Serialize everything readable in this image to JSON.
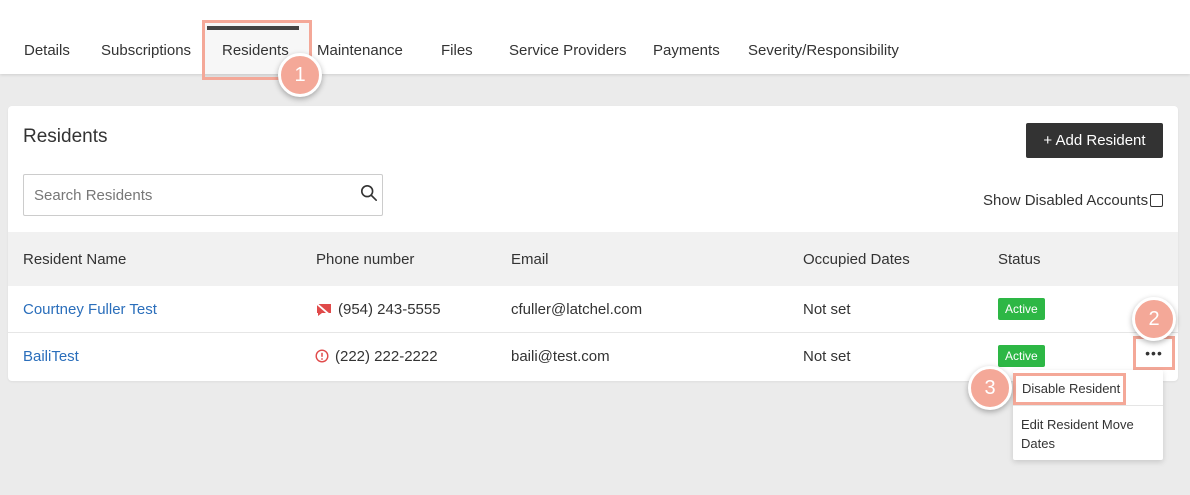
{
  "nav": {
    "tabs": [
      "Details",
      "Subscriptions",
      "Residents",
      "Maintenance",
      "Files",
      "Service Providers",
      "Payments",
      "Severity/Responsibility"
    ],
    "active_tab": "Residents"
  },
  "annotations": [
    "1",
    "2",
    "3"
  ],
  "residents_panel": {
    "title": "Residents",
    "add_button": "+ Add Resident",
    "search_placeholder": "Search Residents",
    "show_disabled_label": "Show Disabled Accounts",
    "columns": [
      "Resident Name",
      "Phone number",
      "Email",
      "Occupied Dates",
      "Status"
    ],
    "rows": [
      {
        "name": "Courtney Fuller Test",
        "phone": "(954) 243-5555",
        "phone_icon": "no-sms-icon",
        "email": "cfuller@latchel.com",
        "dates": "Not set",
        "status": "Active"
      },
      {
        "name": "BailiTest",
        "phone": "(222) 222-2222",
        "phone_icon": "warning-icon",
        "email": "baili@test.com",
        "dates": "Not set",
        "status": "Active"
      }
    ],
    "more_label": "•••"
  },
  "row_menu": {
    "items": [
      "Disable Resident",
      "Edit Resident Move Dates"
    ]
  },
  "colors": {
    "highlight": "#f4a898",
    "active_status": "#2db745",
    "link": "#2a6ebb",
    "button_dark": "#333333"
  }
}
